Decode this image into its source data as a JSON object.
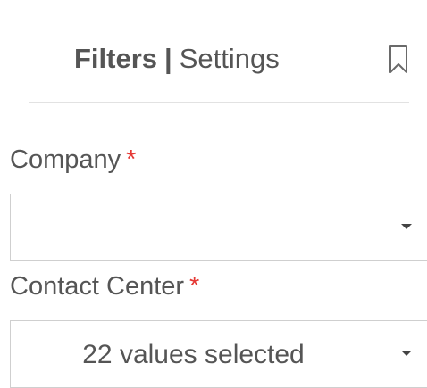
{
  "tabs": {
    "filters_label": "Filters",
    "separator": "|",
    "settings_label": "Settings"
  },
  "bookmark": {
    "icon": "bookmark-icon"
  },
  "fields": [
    {
      "label": "Company",
      "required_marker": "*",
      "value": ""
    },
    {
      "label": "Contact Center",
      "required_marker": "*",
      "value": "22 values selected"
    }
  ],
  "colors": {
    "required": "#e53935",
    "text": "#555555",
    "border": "#cfcfcf"
  }
}
